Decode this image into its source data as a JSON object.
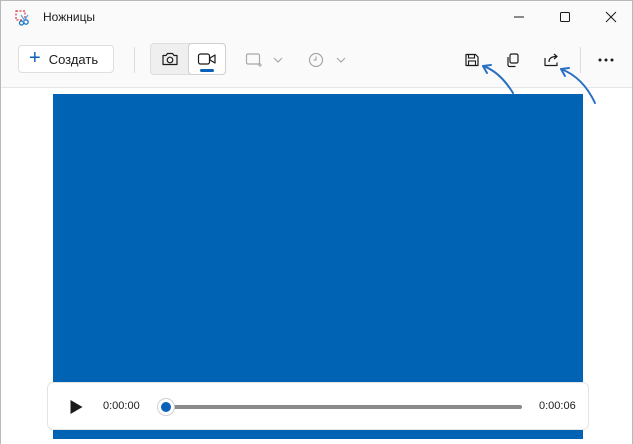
{
  "window": {
    "title": "Ножницы"
  },
  "toolbar": {
    "new_label": "Создать",
    "new_icon": "plus-icon",
    "modes": [
      {
        "name": "screenshot-mode",
        "icon": "camera-icon",
        "selected": false
      },
      {
        "name": "video-mode",
        "icon": "video-camera-icon",
        "selected": true
      }
    ],
    "actions": [
      {
        "name": "save",
        "icon": "save-icon"
      },
      {
        "name": "copy",
        "icon": "copy-icon"
      },
      {
        "name": "share",
        "icon": "share-icon"
      },
      {
        "name": "more",
        "icon": "more-icon"
      }
    ]
  },
  "player": {
    "current_time": "0:00:00",
    "total_time": "0:00:06",
    "progress": 0
  },
  "colors": {
    "accent": "#0a62b8",
    "video_background": "#0063b4",
    "annotation_arrow": "#2a6fc1"
  }
}
